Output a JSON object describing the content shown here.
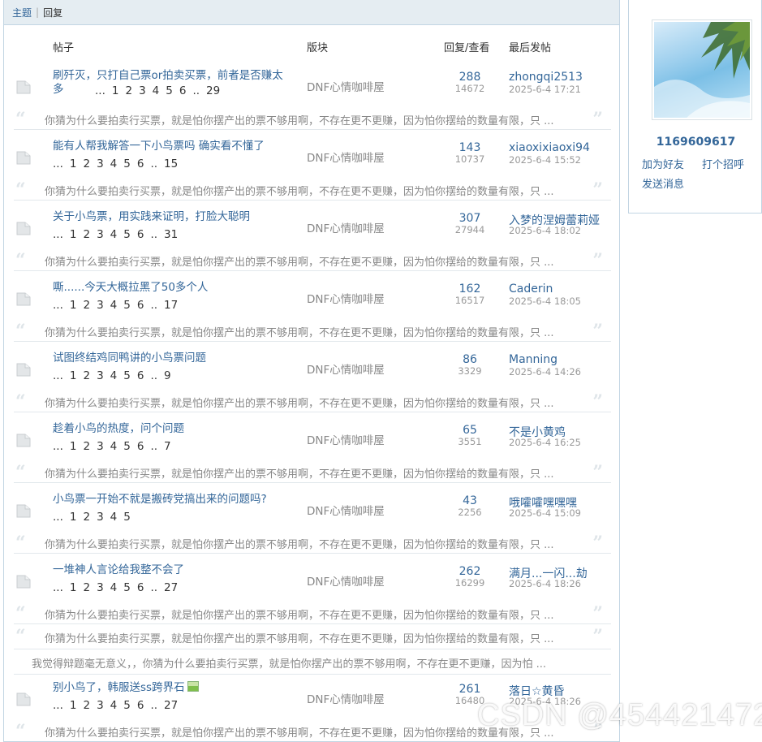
{
  "tabs": {
    "topics": "主题",
    "replies": "回复"
  },
  "columns": {
    "post": "帖子",
    "forum": "版块",
    "reply_view": "回复/查看",
    "last_post": "最后发帖"
  },
  "threads": [
    {
      "title": "刷歼灭，只打自己票or拍卖买票，前者是否赚太多",
      "pages": [
        "...",
        "1",
        "2",
        "3",
        "4",
        "5",
        "6",
        "..",
        "29"
      ],
      "forum": "DNF心情咖啡屋",
      "replies": "288",
      "views": "14672",
      "last_user": "zhongqi2513",
      "last_time": "2025-6-4 17:21",
      "quote": "你猜为什么要拍卖行买票，就是怕你摆产出的票不够用啊，不存在更不更赚，因为怕你摆给的数量有限，只 ..."
    },
    {
      "title": "能有人帮我解答一下小鸟票吗 确实看不懂了",
      "pages": [
        "...",
        "1",
        "2",
        "3",
        "4",
        "5",
        "6",
        "..",
        "15"
      ],
      "forum": "DNF心情咖啡屋",
      "replies": "143",
      "views": "10737",
      "last_user": "xiaoxixiaoxi94",
      "last_time": "2025-6-4 15:52",
      "quote": "你猜为什么要拍卖行买票，就是怕你摆产出的票不够用啊，不存在更不更赚，因为怕你摆给的数量有限，只 ..."
    },
    {
      "title": "关于小鸟票，用实践来证明，打脸大聪明",
      "pages": [
        "...",
        "1",
        "2",
        "3",
        "4",
        "5",
        "6",
        "..",
        "31"
      ],
      "forum": "DNF心情咖啡屋",
      "replies": "307",
      "views": "27944",
      "last_user": "入梦的涅姆蕾莉娅",
      "last_time": "2025-6-4 18:02",
      "quote": "你猜为什么要拍卖行买票，就是怕你摆产出的票不够用啊，不存在更不更赚，因为怕你摆给的数量有限，只 ..."
    },
    {
      "title": "嘶......今天大概拉黑了50多个人",
      "pages": [
        "...",
        "1",
        "2",
        "3",
        "4",
        "5",
        "6",
        "..",
        "17"
      ],
      "forum": "DNF心情咖啡屋",
      "replies": "162",
      "views": "16517",
      "last_user": "Caderin",
      "last_time": "2025-6-4 18:05",
      "quote": "你猜为什么要拍卖行买票，就是怕你摆产出的票不够用啊，不存在更不更赚，因为怕你摆给的数量有限，只 ..."
    },
    {
      "title": "试图终结鸡同鸭讲的小鸟票问题",
      "pages": [
        "...",
        "1",
        "2",
        "3",
        "4",
        "5",
        "6",
        "..",
        "9"
      ],
      "forum": "DNF心情咖啡屋",
      "replies": "86",
      "views": "3329",
      "last_user": "Manning",
      "last_time": "2025-6-4 14:26",
      "quote": "你猜为什么要拍卖行买票，就是怕你摆产出的票不够用啊，不存在更不更赚，因为怕你摆给的数量有限，只 ..."
    },
    {
      "title": "趁着小鸟的热度，问个问题",
      "pages": [
        "...",
        "1",
        "2",
        "3",
        "4",
        "5",
        "6",
        "..",
        "7"
      ],
      "forum": "DNF心情咖啡屋",
      "replies": "65",
      "views": "3551",
      "last_user": "不是小黄鸡",
      "last_time": "2025-6-4 16:25",
      "quote": "你猜为什么要拍卖行买票，就是怕你摆产出的票不够用啊，不存在更不更赚，因为怕你摆给的数量有限，只 ..."
    },
    {
      "title": "小鸟票一开始不就是搬砖党搞出来的问题吗?",
      "pages": [
        "...",
        "1",
        "2",
        "3",
        "4",
        "5"
      ],
      "forum": "DNF心情咖啡屋",
      "replies": "43",
      "views": "2256",
      "last_user": "哦嚯嚯嘿嘿嘿",
      "last_time": "2025-6-4 15:09",
      "quote": "你猜为什么要拍卖行买票，就是怕你摆产出的票不够用啊，不存在更不更赚，因为怕你摆给的数量有限，只 ..."
    },
    {
      "title": "一堆神人言论给我整不会了",
      "pages": [
        "...",
        "1",
        "2",
        "3",
        "4",
        "5",
        "6",
        "..",
        "27"
      ],
      "forum": "DNF心情咖啡屋",
      "replies": "262",
      "views": "16299",
      "last_user": "满月...一闪...劫",
      "last_time": "2025-6-4 18:26",
      "quote": "你猜为什么要拍卖行买票，就是怕你摆产出的票不够用啊，不存在更不更赚，因为怕你摆给的数量有限，只 ..."
    },
    {
      "title": "别小鸟了，韩服送ss跨界石",
      "pages": [
        "...",
        "1",
        "2",
        "3",
        "4",
        "5",
        "6",
        "..",
        "27"
      ],
      "forum": "DNF心情咖啡屋",
      "replies": "261",
      "views": "16480",
      "last_user": "落日☆黄昏",
      "last_time": "2025-6-4 18:26",
      "quote": "你猜为什么要拍卖行买票，就是怕你摆产出的票不够用啊，不存在更不更赚，因为怕你摆给的数量有限，只 ..."
    }
  ],
  "extra_quotes": [
    "你猜为什么要拍卖行买票，就是怕你摆产出的票不够用啊，不存在更不更赚，因为怕你摆给的数量有限，只 ...",
    "我觉得辩题毫无意义，，你猜为什么要拍卖行买票，就是怕你摆产出的票不够用啊，不存在更不更赚，因为怕 ..."
  ],
  "profile": {
    "username": "1169609617",
    "add_friend": "加为好友",
    "greet": "打个招呼",
    "send_message": "发送消息"
  },
  "watermark": "CSDN @454421472"
}
